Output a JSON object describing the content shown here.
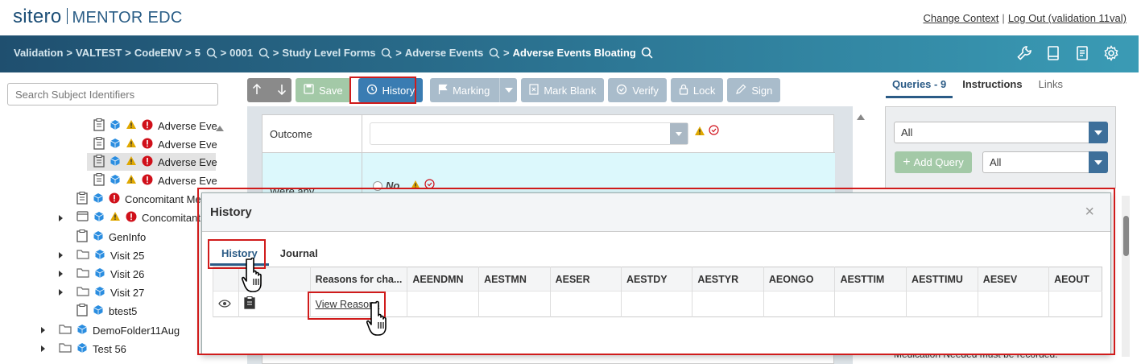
{
  "header": {
    "logo_brand": "sitero",
    "logo_product": "MENTOR EDC",
    "change_context": "Change Context",
    "separator": "|",
    "logout": "Log Out (validation 11val)"
  },
  "breadcrumb": {
    "items": [
      "Validation",
      "VALTEST",
      "CodeENV",
      "5",
      "0001",
      "Study Level Forms",
      "Adverse Events"
    ],
    "current": "Adverse Events Bloating",
    "sep": ">"
  },
  "left": {
    "search_placeholder": "Search Subject Identifiers",
    "tree": [
      {
        "label": "Adverse Eve"
      },
      {
        "label": "Adverse Eve"
      },
      {
        "label": "Adverse Eve"
      },
      {
        "label": "Adverse Eve"
      },
      {
        "label": "Concomitant Me"
      },
      {
        "label": "Concomitant"
      },
      {
        "label": "GenInfo"
      },
      {
        "label": "Visit 25"
      },
      {
        "label": "Visit 26"
      },
      {
        "label": "Visit 27"
      },
      {
        "label": "btest5"
      },
      {
        "label": "DemoFolder11Aug"
      },
      {
        "label": "Test 56"
      }
    ]
  },
  "toolbar": {
    "save": "Save",
    "history": "History",
    "marking": "Marking",
    "mark_blank": "Mark Blank",
    "verify": "Verify",
    "lock": "Lock",
    "sign": "Sign"
  },
  "form": {
    "outcome_label": "Outcome",
    "were_any_label": "Were any",
    "no_option": "No"
  },
  "right": {
    "tabs": {
      "queries": "Queries - 9",
      "instructions": "Instructions",
      "links": "Links"
    },
    "filter1": "All",
    "filter2": "All",
    "add_query": "Add Query",
    "note": "Medication Needed must be recorded."
  },
  "modal": {
    "title": "History",
    "close": "×",
    "tabs": {
      "history": "History",
      "journal": "Journal"
    },
    "columns": [
      "Reasons for cha...",
      "AEENDMN",
      "AESTMN",
      "AESER",
      "AESTDY",
      "AESTYR",
      "AEONGO",
      "AESTTIM",
      "AESTTIMU",
      "AESEV",
      "AEOUT"
    ],
    "row_link": "View Reasons"
  },
  "colors": {
    "accent_blue": "#3a7cb2",
    "highlight_red": "#d01b1b",
    "warning_yellow": "#e0a800",
    "error_red": "#d0101a",
    "brand_navy": "#1d4f77"
  }
}
